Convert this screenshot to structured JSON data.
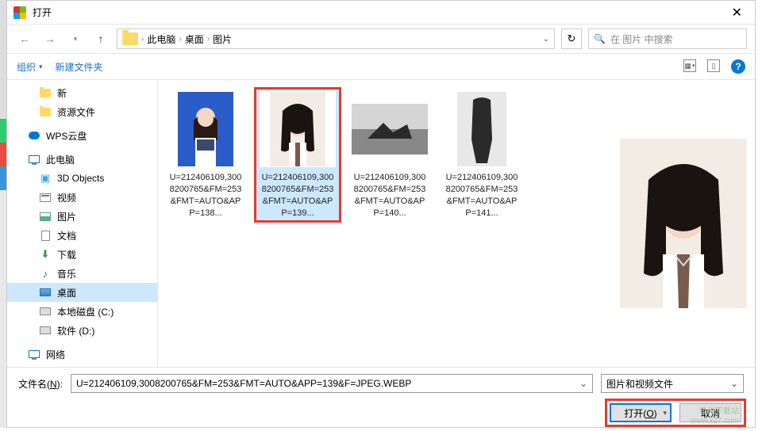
{
  "titlebar": {
    "title": "打开"
  },
  "breadcrumb": {
    "pc": "此电脑",
    "desk": "桌面",
    "pics": "图片"
  },
  "search": {
    "placeholder": "在 图片 中搜索"
  },
  "toolbar": {
    "org": "组织",
    "newf": "新建文件夹"
  },
  "sidebar": {
    "new": "新",
    "res": "资源文件",
    "wps": "WPS云盘",
    "pc": "此电脑",
    "obj": "3D Objects",
    "video": "视频",
    "pic": "图片",
    "doc": "文档",
    "dl": "下载",
    "music": "音乐",
    "desk": "桌面",
    "diskC": "本地磁盘 (C:)",
    "diskD": "软件 (D:)",
    "net": "网络"
  },
  "files": [
    {
      "name": "U=212406109,3008200765&FM=253&FMT=AUTO&APP=138..."
    },
    {
      "name": "U=212406109,3008200765&FM=253&FMT=AUTO&APP=139..."
    },
    {
      "name": "U=212406109,3008200765&FM=253&FMT=AUTO&APP=140..."
    },
    {
      "name": "U=212406109,3008200765&FM=253&FMT=AUTO&APP=141..."
    }
  ],
  "footer": {
    "fnlabel": "文件名(N):",
    "fnvalue": "U=212406109,3008200765&FM=253&FMT=AUTO&APP=139&F=JPEG.WEBP",
    "filter": "图片和视频文件",
    "open": "打开(O)",
    "cancel": "取消"
  },
  "watermark": {
    "l1": "极光下载站",
    "l2": "www.xz7.com"
  }
}
